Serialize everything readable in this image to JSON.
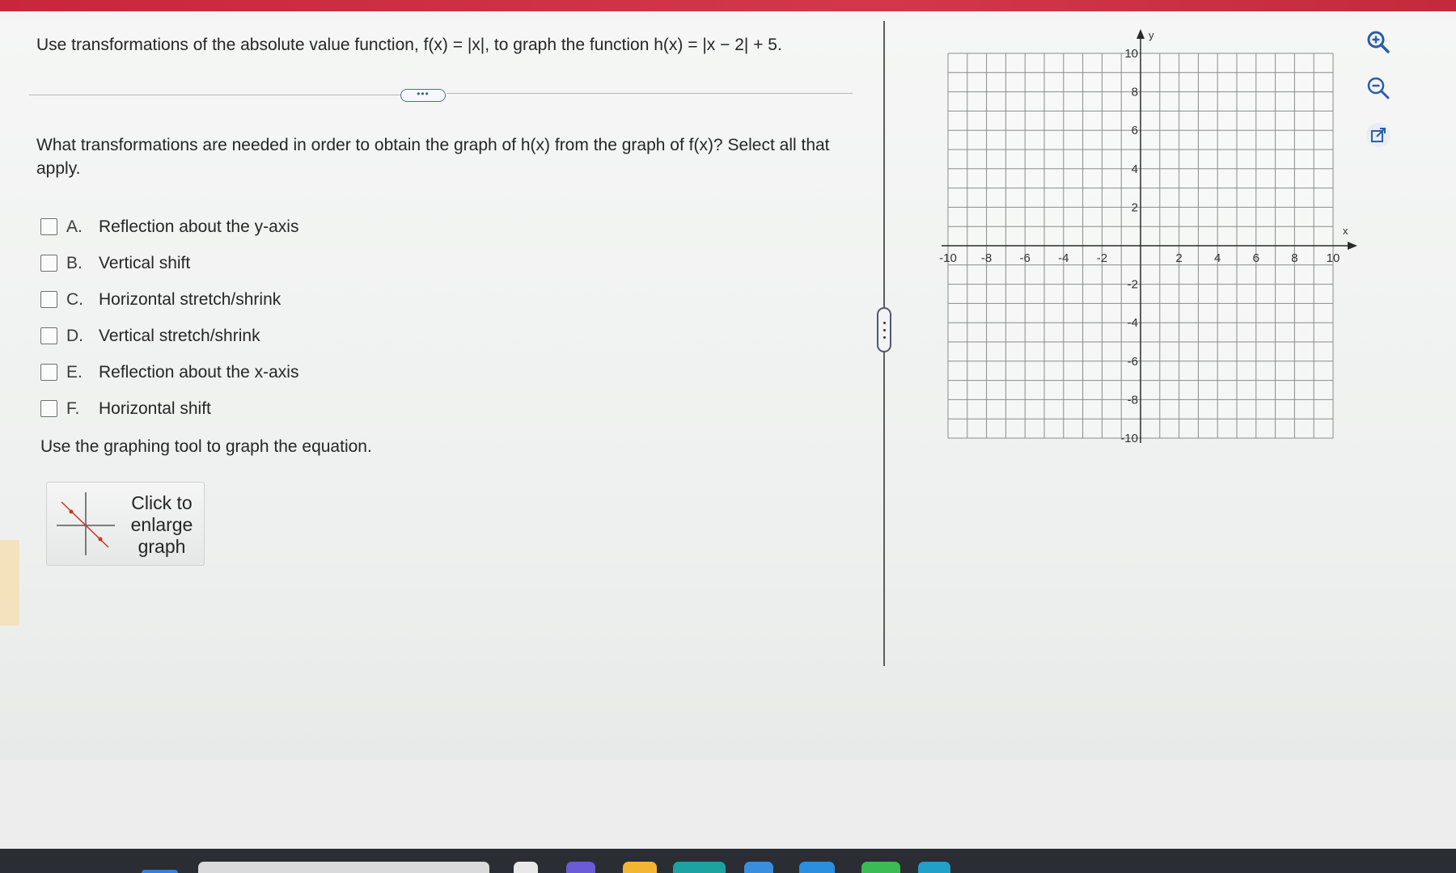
{
  "question": {
    "intro": "Use transformations of the absolute value function, f(x) = |x|, to graph the function h(x) = |x − 2| + 5.",
    "expand_label": "•••",
    "prompt": "What transformations are needed in order to obtain the graph of h(x) from the graph of f(x)? Select all that apply.",
    "options": [
      {
        "letter": "A.",
        "label": "Reflection about the y-axis",
        "checked": false
      },
      {
        "letter": "B.",
        "label": "Vertical shift",
        "checked": false
      },
      {
        "letter": "C.",
        "label": "Horizontal stretch/shrink",
        "checked": false
      },
      {
        "letter": "D.",
        "label": "Vertical stretch/shrink",
        "checked": false
      },
      {
        "letter": "E.",
        "label": "Reflection about the x-axis",
        "checked": false
      },
      {
        "letter": "F.",
        "label": "Horizontal shift",
        "checked": false
      }
    ],
    "graph_instruction": "Use the graphing tool to graph the equation.",
    "enlarge_label": "Click to enlarge graph"
  },
  "graph": {
    "x_axis_label": "x",
    "y_axis_label": "y",
    "x_range": [
      -10,
      10
    ],
    "y_range": [
      -10,
      10
    ],
    "grid_step": 1,
    "x_tick_labels": [
      "-10",
      "-8",
      "-6",
      "-4",
      "-2",
      "2",
      "4",
      "6",
      "8",
      "10"
    ],
    "y_tick_labels": [
      "10",
      "8",
      "6",
      "4",
      "2",
      "-2",
      "-4",
      "-6",
      "-8",
      "-10"
    ]
  },
  "toolbar": {
    "zoom_in": "zoom-in-icon",
    "zoom_out": "zoom-out-icon",
    "popout": "external-link-icon"
  },
  "colors": {
    "header": "#c8273b",
    "accent_blue": "#2a5da8",
    "grid_line": "#8a8c8c",
    "axis": "#2a2a2a"
  }
}
